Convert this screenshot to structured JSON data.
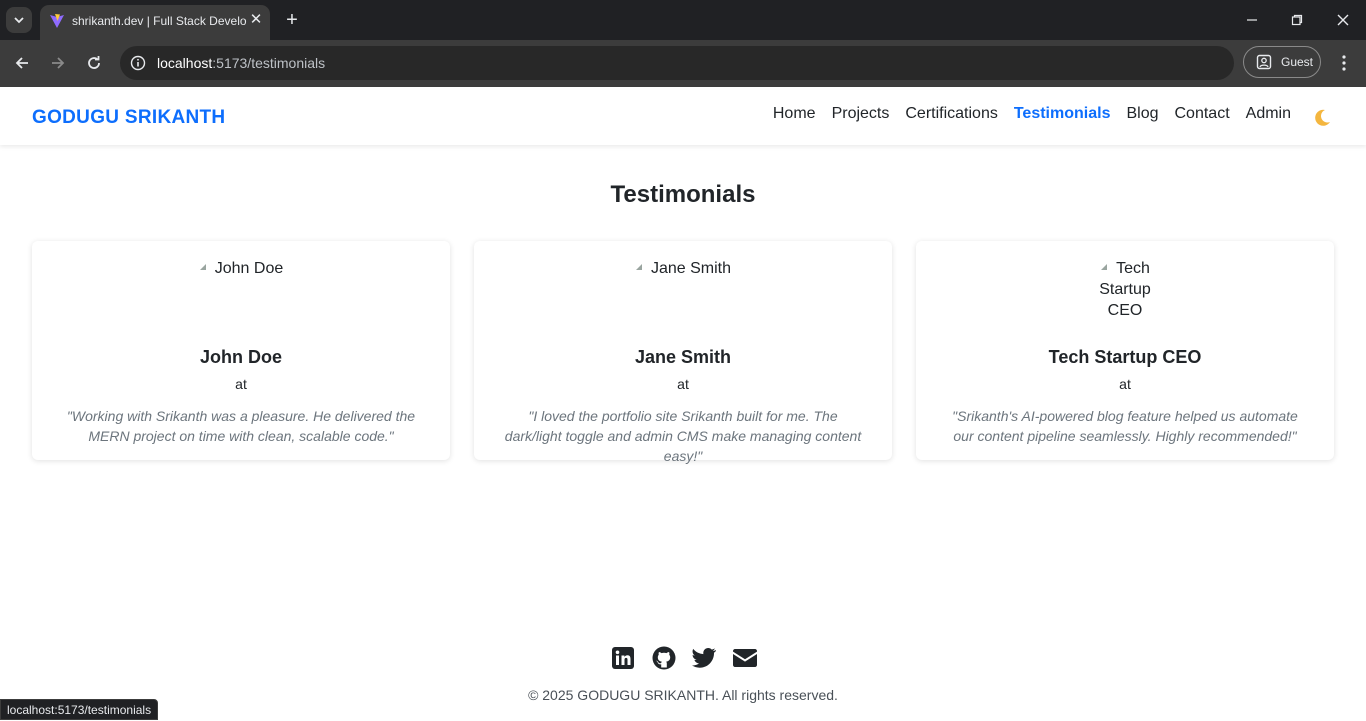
{
  "browser": {
    "tab_title": "shrikanth.dev | Full Stack Developer",
    "url_host": "localhost",
    "url_rest": ":5173/testimonials",
    "profile_label": "Guest",
    "status_url": "localhost:5173/testimonials"
  },
  "header": {
    "brand": "GODUGU SRIKANTH",
    "nav": [
      "Home",
      "Projects",
      "Certifications",
      "Testimonials",
      "Blog",
      "Contact",
      "Admin"
    ],
    "active_nav": "Testimonials",
    "theme_icon": "moon-icon"
  },
  "page": {
    "title": "Testimonials"
  },
  "testimonials": [
    {
      "avatar_alt": "John Doe",
      "name": "John Doe",
      "at": "at",
      "quote": "\"Working with Srikanth was a pleasure. He delivered the MERN project on time with clean, scalable code.\""
    },
    {
      "avatar_alt": "Jane Smith",
      "name": "Jane Smith",
      "at": "at",
      "quote": "\"I loved the portfolio site Srikanth built for me. The dark/light toggle and admin CMS make managing content easy!\""
    },
    {
      "avatar_alt": "Tech Startup CEO",
      "name": "Tech Startup CEO",
      "at": "at",
      "quote": "\"Srikanth's AI-powered blog feature helped us automate our content pipeline seamlessly. Highly recommended!\""
    }
  ],
  "footer": {
    "icons": [
      "linkedin-icon",
      "github-icon",
      "twitter-icon",
      "email-icon"
    ],
    "copyright": "© 2025 GODUGU SRIKANTH. All rights reserved."
  },
  "colors": {
    "accent": "#0d6efd",
    "text": "#212529",
    "muted": "#6c757d"
  }
}
